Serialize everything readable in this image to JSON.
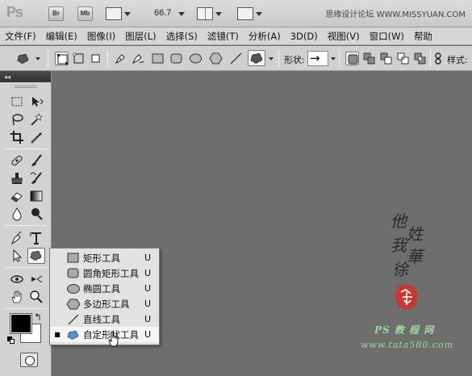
{
  "appbar": {
    "logo": "Ps",
    "bridge_label": "Br",
    "minibridge_label": "Mb",
    "zoom": "66.7",
    "site_watermark": "思缘设计论坛 WWW.MISSYUAN.COM"
  },
  "menubar": {
    "items": [
      "文件(F)",
      "编辑(E)",
      "图像(I)",
      "图层(L)",
      "选择(S)",
      "滤镜(T)",
      "分析(A)",
      "3D(D)",
      "视图(V)",
      "窗口(W)",
      "帮助"
    ]
  },
  "optionsbar": {
    "shape_label": "形状:",
    "shape_value": "→",
    "style_label": "样式:"
  },
  "flyout": {
    "items": [
      {
        "label": "矩形工具",
        "key": "U",
        "icon": "rectangle-icon",
        "current": false
      },
      {
        "label": "圆角矩形工具",
        "key": "U",
        "icon": "rounded-rectangle-icon",
        "current": false
      },
      {
        "label": "椭圆工具",
        "key": "U",
        "icon": "ellipse-icon",
        "current": false
      },
      {
        "label": "多边形工具",
        "key": "U",
        "icon": "polygon-icon",
        "current": false
      },
      {
        "label": "直线工具",
        "key": "U",
        "icon": "line-icon",
        "current": false
      },
      {
        "label": "自定形状工具",
        "key": "U",
        "icon": "custom-shape-icon",
        "current": true
      }
    ]
  },
  "watermark": {
    "callig_1": "他",
    "callig_2": "姓",
    "callig_3": "我",
    "callig_4": "華",
    "callig_5": "徐",
    "site": "PS 教 程 网",
    "url": "www.tata580.com"
  },
  "colors": {
    "canvas_bg": "#6e6e6e",
    "foreground": "#000000",
    "background": "#ffffff",
    "accent_shape": "#5b8fc7"
  }
}
